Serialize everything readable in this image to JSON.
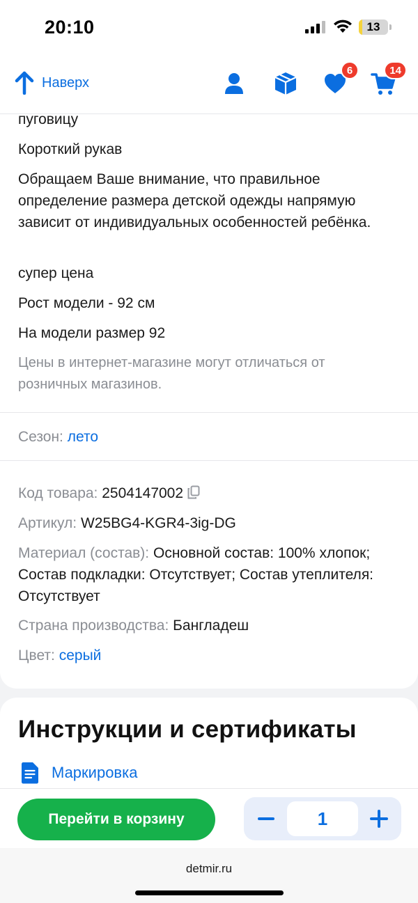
{
  "status_bar": {
    "time": "20:10",
    "battery": "13",
    "battery_level": 0.13
  },
  "nav": {
    "back_label": "Наверх",
    "favorites_badge": "6",
    "cart_badge": "14",
    "icons": [
      "arrow-up-icon",
      "profile-icon",
      "box-icon",
      "heart-icon",
      "cart-icon"
    ],
    "accent_color": "#0b6ee0",
    "badge_color": "#ee3b2c"
  },
  "description": {
    "lines": [
      "пуговицу",
      "Короткий рукав",
      "Обращаем Ваше внимание, что правильное определение размера детской одежды напрямую зависит от индивидуальных особенностей ребёнка.",
      "супер цена",
      "Рост модели - 92 см",
      "На модели размер 92"
    ],
    "disclaimer": "Цены в интернет-магазине могут отличаться от розничных магазинов."
  },
  "season": {
    "label": "Сезон:",
    "value": "лето"
  },
  "specs": {
    "code_label": "Код товара:",
    "code_value": "2504147002",
    "article_label": "Артикул:",
    "article_value": "W25BG4-KGR4-3ig-DG",
    "material_label": "Материал (состав):",
    "material_value": "Основной состав: 100% хлопок; Состав подкладки: Отсутствует; Состав утеплителя: Отсутствует",
    "country_label": "Страна производства:",
    "country_value": "Бангладеш",
    "color_label": "Цвет:",
    "color_value": "серый"
  },
  "instructions": {
    "title": "Инструкции и сертификаты",
    "items": [
      {
        "label": "Маркировка",
        "icon": "document-icon"
      }
    ]
  },
  "bottom": {
    "cart_button": "Перейти в корзину",
    "quantity": "1",
    "button_color": "#16b14b"
  },
  "browser": {
    "url": "detmir.ru"
  }
}
